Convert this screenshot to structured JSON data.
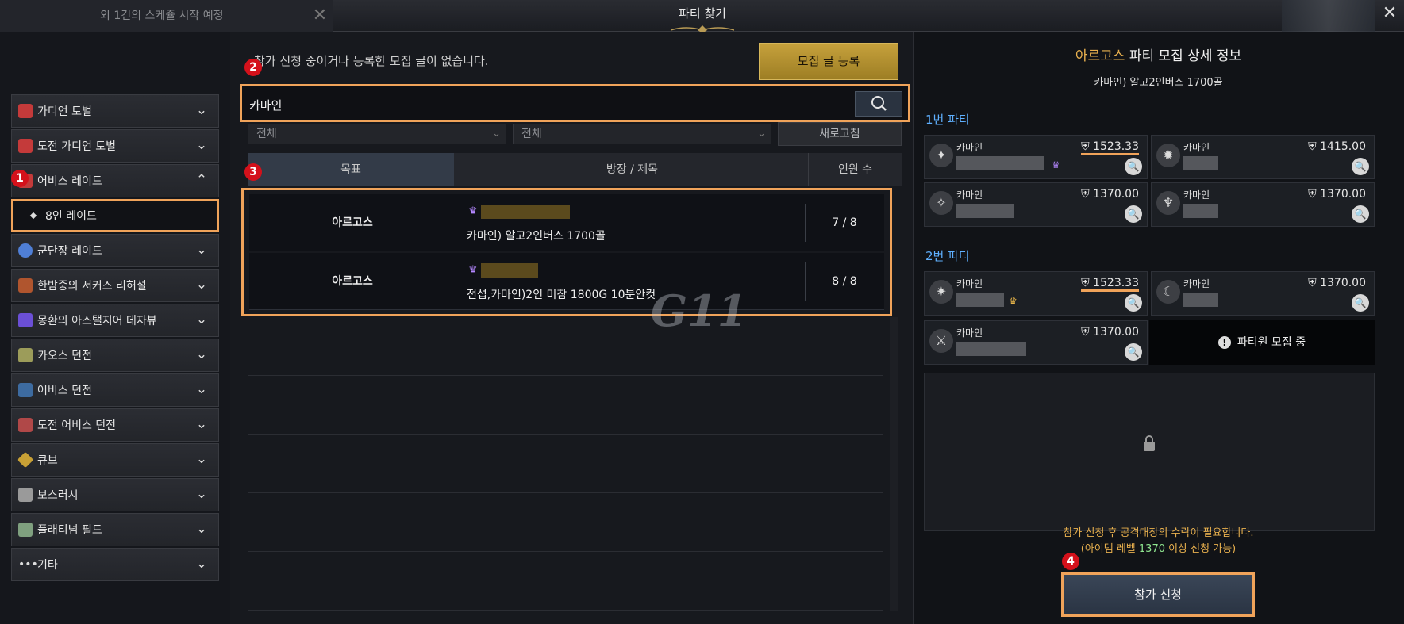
{
  "window": {
    "title": "파티 찾기",
    "bg_tab": "외 1건의 스케쥴 시작 예정",
    "close": "X"
  },
  "sidebar": {
    "items": [
      {
        "label": "가디언 토벌",
        "color": "#c43a3a"
      },
      {
        "label": "도전 가디언 토벌",
        "color": "#c43a3a"
      },
      {
        "label": "어비스 레이드",
        "color": "#c43a3a",
        "expanded": true
      },
      {
        "label": "군단장 레이드",
        "color": "#4f7fd6"
      },
      {
        "label": "한밤중의 서커스 리허설",
        "color": "#b0552e"
      },
      {
        "label": "몽환의 아스탤지어 데자뷰",
        "color": "#6b4fd6"
      },
      {
        "label": "카오스 던전",
        "color": "#9c9c5a"
      },
      {
        "label": "어비스 던전",
        "color": "#3d6ba0"
      },
      {
        "label": "도전 어비스 던전",
        "color": "#b04848"
      },
      {
        "label": "큐브",
        "color": "#c8a035"
      },
      {
        "label": "보스러시",
        "color": "#9a9a9a"
      },
      {
        "label": "플래티넘 필드",
        "color": "#7fa07f"
      },
      {
        "label": "기타",
        "color": "#bdbdbd"
      }
    ],
    "sub_item": "8인 레이드"
  },
  "main": {
    "message": "참가 신청 중이거나 등록한 모집 글이 없습니다.",
    "register_button": "모집 글 등록",
    "search_value": "카마인",
    "filter1": "전체",
    "filter2": "전체",
    "refresh_button": "새로고침",
    "columns": {
      "goal": "목표",
      "title": "방장 / 제목",
      "count": "인원 수"
    },
    "rows": [
      {
        "goal": "아르고스",
        "title": "카마인) 알고2인버스 1700골",
        "count": "7 / 8"
      },
      {
        "goal": "아르고스",
        "title": "전섭,카마인)2인 미참 1800G 10분안컷",
        "count": "8 / 8"
      }
    ],
    "watermark": "G11"
  },
  "detail": {
    "title_accent": "아르고스",
    "title_rest": "파티 모집 상세 정보",
    "subtitle": "카마인) 알고2인버스 1700골",
    "party1_label": "1번 파티",
    "party2_label": "2번 파티",
    "party1": [
      {
        "server": "카마인",
        "ilvl": "1523.33",
        "leader": true
      },
      {
        "server": "카마인",
        "ilvl": "1415.00",
        "leader": false
      },
      {
        "server": "카마인",
        "ilvl": "1370.00",
        "leader": false
      },
      {
        "server": "카마인",
        "ilvl": "1370.00",
        "leader": false
      }
    ],
    "party2": [
      {
        "server": "카마인",
        "ilvl": "1523.33",
        "leader": true
      },
      {
        "server": "카마인",
        "ilvl": "1370.00",
        "leader": false
      },
      {
        "server": "카마인",
        "ilvl": "1370.00",
        "leader": false
      }
    ],
    "recruiting": "파티원 모집 중",
    "notice_line1": "참가 신청 후 공격대장의 수락이 필요합니다.",
    "notice_line2_pre": "(아이템 레벨 ",
    "notice_level": "1370",
    "notice_line2_post": " 이상 신청 가능)",
    "join_button": "참가 신청"
  },
  "markers": [
    "1",
    "2",
    "3",
    "4"
  ]
}
